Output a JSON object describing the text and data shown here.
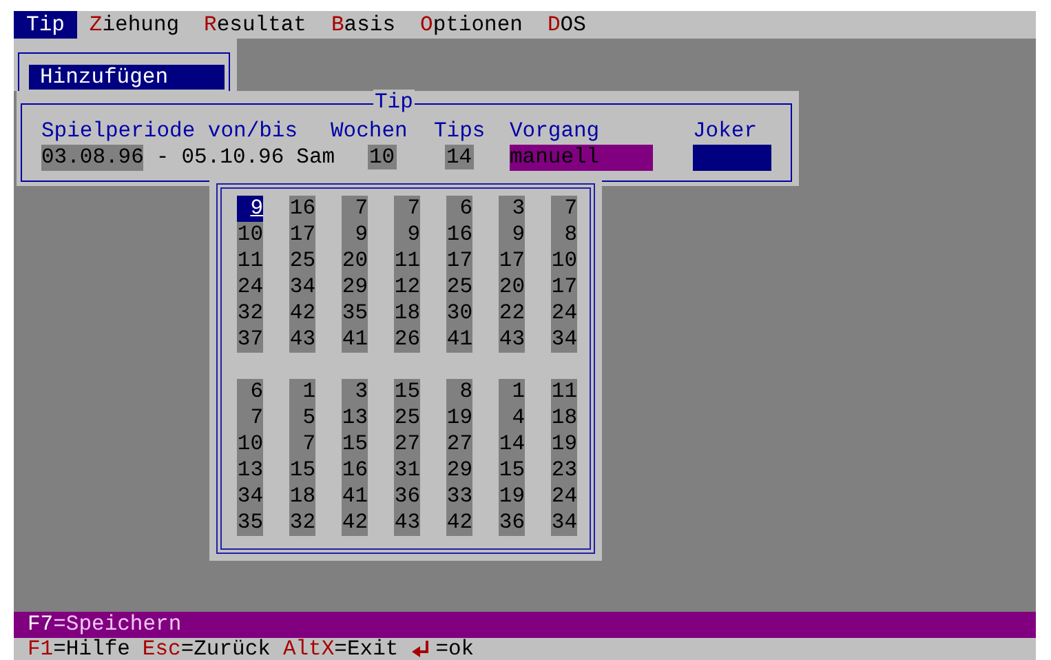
{
  "menu": [
    {
      "hotkey": "T",
      "rest": "ip",
      "selected": true
    },
    {
      "hotkey": "Z",
      "rest": "iehung",
      "selected": false
    },
    {
      "hotkey": "R",
      "rest": "esultat",
      "selected": false
    },
    {
      "hotkey": "B",
      "rest": "asis",
      "selected": false
    },
    {
      "hotkey": "O",
      "rest": "ptionen",
      "selected": false
    },
    {
      "hotkey": "D",
      "rest": "OS",
      "selected": false
    }
  ],
  "submenu": {
    "items": [
      {
        "label": "Hinzufügen",
        "selected": true
      }
    ]
  },
  "dialog": {
    "title": "Tip",
    "labels": {
      "period": "Spielperiode von/bis",
      "weeks": "Wochen",
      "tips": "Tips",
      "mode": "Vorgang",
      "joker": "Joker"
    },
    "period_from": "03.08.96",
    "separator": "-",
    "period_to": "05.10.96",
    "weekday": "Sam",
    "weeks": "10",
    "tips": "14",
    "mode": "manuell"
  },
  "tips": [
    {
      "numbers": [
        {
          "n": "9",
          "selected": true
        },
        {
          "n": "10",
          "selected": false
        },
        {
          "n": "11",
          "selected": false
        },
        {
          "n": "24",
          "selected": false
        },
        {
          "n": "32",
          "selected": false
        },
        {
          "n": "37",
          "selected": false
        }
      ]
    },
    {
      "numbers": [
        {
          "n": "16",
          "selected": false
        },
        {
          "n": "17",
          "selected": false
        },
        {
          "n": "25",
          "selected": false
        },
        {
          "n": "34",
          "selected": false
        },
        {
          "n": "42",
          "selected": false
        },
        {
          "n": "43",
          "selected": false
        }
      ]
    },
    {
      "numbers": [
        {
          "n": "7",
          "selected": false
        },
        {
          "n": "9",
          "selected": false
        },
        {
          "n": "20",
          "selected": false
        },
        {
          "n": "29",
          "selected": false
        },
        {
          "n": "35",
          "selected": false
        },
        {
          "n": "41",
          "selected": false
        }
      ]
    },
    {
      "numbers": [
        {
          "n": "7",
          "selected": false
        },
        {
          "n": "9",
          "selected": false
        },
        {
          "n": "11",
          "selected": false
        },
        {
          "n": "12",
          "selected": false
        },
        {
          "n": "18",
          "selected": false
        },
        {
          "n": "26",
          "selected": false
        }
      ]
    },
    {
      "numbers": [
        {
          "n": "6",
          "selected": false
        },
        {
          "n": "16",
          "selected": false
        },
        {
          "n": "17",
          "selected": false
        },
        {
          "n": "25",
          "selected": false
        },
        {
          "n": "30",
          "selected": false
        },
        {
          "n": "41",
          "selected": false
        }
      ]
    },
    {
      "numbers": [
        {
          "n": "3",
          "selected": false
        },
        {
          "n": "9",
          "selected": false
        },
        {
          "n": "17",
          "selected": false
        },
        {
          "n": "20",
          "selected": false
        },
        {
          "n": "22",
          "selected": false
        },
        {
          "n": "43",
          "selected": false
        }
      ]
    },
    {
      "numbers": [
        {
          "n": "7",
          "selected": false
        },
        {
          "n": "8",
          "selected": false
        },
        {
          "n": "10",
          "selected": false
        },
        {
          "n": "17",
          "selected": false
        },
        {
          "n": "24",
          "selected": false
        },
        {
          "n": "34",
          "selected": false
        }
      ]
    },
    {
      "numbers": [
        {
          "n": "6",
          "selected": false
        },
        {
          "n": "7",
          "selected": false
        },
        {
          "n": "10",
          "selected": false
        },
        {
          "n": "13",
          "selected": false
        },
        {
          "n": "34",
          "selected": false
        },
        {
          "n": "35",
          "selected": false
        }
      ]
    },
    {
      "numbers": [
        {
          "n": "1",
          "selected": false
        },
        {
          "n": "5",
          "selected": false
        },
        {
          "n": "7",
          "selected": false
        },
        {
          "n": "15",
          "selected": false
        },
        {
          "n": "18",
          "selected": false
        },
        {
          "n": "32",
          "selected": false
        }
      ]
    },
    {
      "numbers": [
        {
          "n": "3",
          "selected": false
        },
        {
          "n": "13",
          "selected": false
        },
        {
          "n": "15",
          "selected": false
        },
        {
          "n": "16",
          "selected": false
        },
        {
          "n": "41",
          "selected": false
        },
        {
          "n": "42",
          "selected": false
        }
      ]
    },
    {
      "numbers": [
        {
          "n": "15",
          "selected": false
        },
        {
          "n": "25",
          "selected": false
        },
        {
          "n": "27",
          "selected": false
        },
        {
          "n": "31",
          "selected": false
        },
        {
          "n": "36",
          "selected": false
        },
        {
          "n": "43",
          "selected": false
        }
      ]
    },
    {
      "numbers": [
        {
          "n": "8",
          "selected": false
        },
        {
          "n": "19",
          "selected": false
        },
        {
          "n": "27",
          "selected": false
        },
        {
          "n": "29",
          "selected": false
        },
        {
          "n": "33",
          "selected": false
        },
        {
          "n": "42",
          "selected": false
        }
      ]
    },
    {
      "numbers": [
        {
          "n": "1",
          "selected": false
        },
        {
          "n": "4",
          "selected": false
        },
        {
          "n": "14",
          "selected": false
        },
        {
          "n": "15",
          "selected": false
        },
        {
          "n": "19",
          "selected": false
        },
        {
          "n": "36",
          "selected": false
        }
      ]
    },
    {
      "numbers": [
        {
          "n": "11",
          "selected": false
        },
        {
          "n": "18",
          "selected": false
        },
        {
          "n": "19",
          "selected": false
        },
        {
          "n": "23",
          "selected": false
        },
        {
          "n": "24",
          "selected": false
        },
        {
          "n": "34",
          "selected": false
        }
      ]
    }
  ],
  "action_bar": {
    "key": "F7",
    "text": "=Speichern"
  },
  "status_bar": [
    {
      "kind": "key",
      "key": "F1",
      "text": "=Hilfe"
    },
    {
      "kind": "key",
      "key": "Esc",
      "text": "=Zurück"
    },
    {
      "kind": "key",
      "key": "AltX",
      "text": "=Exit"
    },
    {
      "kind": "enter",
      "text": "=ok"
    }
  ]
}
